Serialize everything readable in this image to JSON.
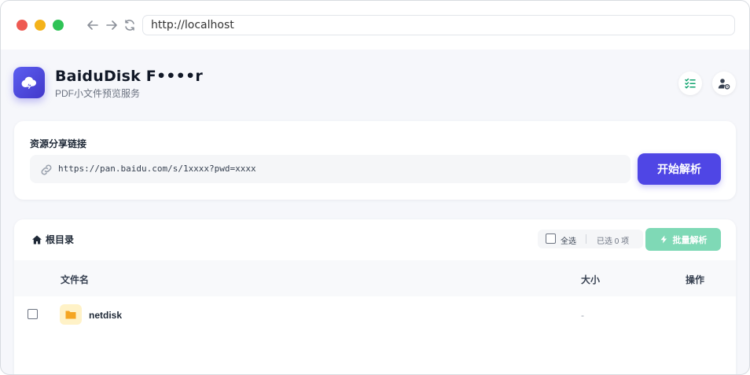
{
  "browser": {
    "url": "http://localhost"
  },
  "app": {
    "title": "BaiduDisk F••••r",
    "subtitle": "PDF小文件预览服务"
  },
  "share": {
    "label": "资源分享链接",
    "url_value": "https://pan.baidu.com/s/1xxxx?pwd=xxxx",
    "parse_button": "开始解析"
  },
  "files": {
    "breadcrumb": "根目录",
    "select_all": "全选",
    "selected_count": "已选 0 项",
    "batch_button": "批量解析",
    "columns": {
      "name": "文件名",
      "size": "大小",
      "action": "操作"
    },
    "rows": [
      {
        "name": "netdisk",
        "size": "-"
      }
    ]
  },
  "colors": {
    "accent": "#4f46e5",
    "batch_disabled": "#7fd9b6",
    "folder": "#f5a623"
  }
}
